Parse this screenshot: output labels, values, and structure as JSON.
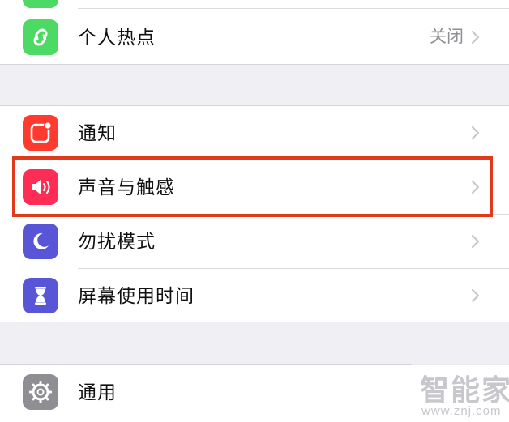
{
  "rows": {
    "hotspot": {
      "label": "个人热点",
      "value": "关闭",
      "icon": "hotspot-link-icon",
      "icon_color": "#4cd964"
    },
    "notifications": {
      "label": "通知",
      "icon": "notifications-icon",
      "icon_color": "#ff3b30"
    },
    "sounds": {
      "label": "声音与触感",
      "icon": "speaker-icon",
      "icon_color": "#ff2d55"
    },
    "dnd": {
      "label": "勿扰模式",
      "icon": "moon-icon",
      "icon_color": "#5856d6"
    },
    "screen_time": {
      "label": "屏幕使用时间",
      "icon": "hourglass-icon",
      "icon_color": "#5856d6"
    },
    "general": {
      "label": "通用",
      "icon": "gear-icon",
      "icon_color": "#8e8e93"
    }
  },
  "highlight_color": "#e03a1a",
  "watermark": {
    "title": "智能家",
    "url": "www.znj.com"
  }
}
